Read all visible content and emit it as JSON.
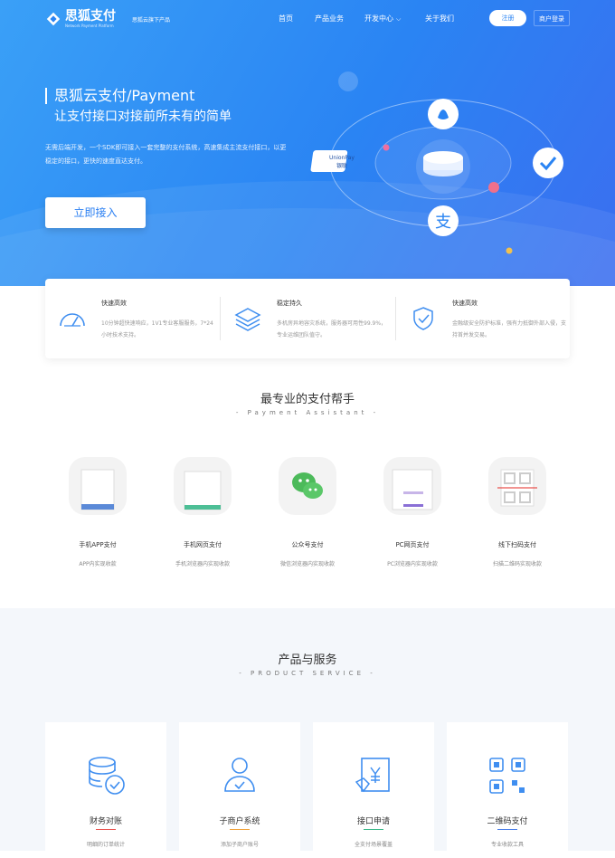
{
  "header": {
    "logo_name": "思狐支付",
    "logo_sub": "Network Payment Platform",
    "slogan": "思狐云旗下产品",
    "nav": [
      "首页",
      "产品业务",
      "开发中心",
      "关于我们"
    ],
    "register": "注册",
    "merchant_login": "商户登录"
  },
  "hero": {
    "title": "思狐云支付/Payment",
    "subtitle": "让支付接口对接前所未有的简单",
    "desc": "无需后端开发，一个SDK即可接入一套完整的支付系统，高速集成主流支付接口，以更稳定的接口，更快的速度直达支付。",
    "cta": "立即接入",
    "unionpay": "UnionPay",
    "unionpay_cn": "银联",
    "alipay_glyph": "支"
  },
  "features": [
    {
      "title": "快速高效",
      "desc": "10分钟超快速响应，1V1专业客服服务，7*24小时技术支持。"
    },
    {
      "title": "稳定持久",
      "desc": "多机房异地容灾系统，服务器可用性99.9%，专业运维团队值守。"
    },
    {
      "title": "快速高效",
      "desc": "金融级安全防护标准，强有力抵御外部入侵，支持首并发交易。"
    }
  ],
  "assistant": {
    "title": "最专业的支付帮手",
    "en": "- Payment Assistant -",
    "items": [
      {
        "title": "手机APP支付",
        "desc": "APP内实现收款"
      },
      {
        "title": "手机网页支付",
        "desc": "手机浏览器内实现收款"
      },
      {
        "title": "公众号支付",
        "desc": "微信浏览器内实现收款"
      },
      {
        "title": "PC网页支付",
        "desc": "PC浏览器内实现收款"
      },
      {
        "title": "线下扫码支付",
        "desc": "扫描二维码实现收款"
      }
    ]
  },
  "products": {
    "title": "产品与服务",
    "en": "- PRODUCT SERVICE -",
    "items": [
      {
        "title": "财务对账",
        "desc": "明细的订单统计",
        "accent": "#e9534f"
      },
      {
        "title": "子商户系统",
        "desc": "添加子商户账号",
        "accent": "#f0a23b"
      },
      {
        "title": "接口申请",
        "desc": "全支付场景覆盖",
        "accent": "#3cb88a"
      },
      {
        "title": "二维码支付",
        "desc": "专业收款工具",
        "accent": "#4a7ee8"
      }
    ]
  },
  "colors": {
    "brand": "#2a84f3",
    "icon": "#3f8ef0"
  }
}
